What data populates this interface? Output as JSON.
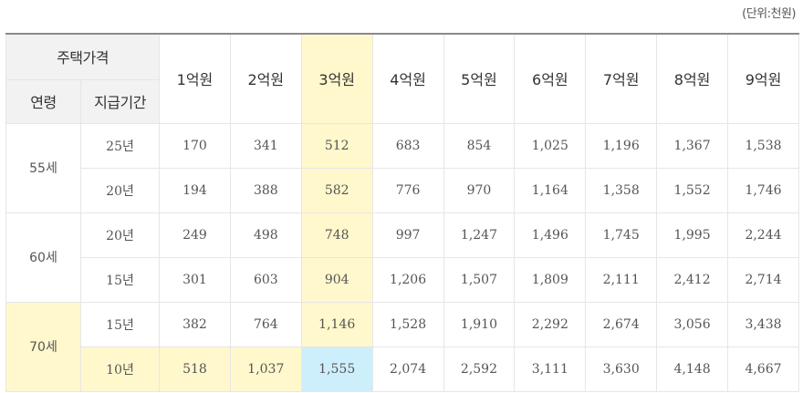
{
  "unit_label": "(단위:천원)",
  "header": {
    "price_label": "주택가격",
    "age_label": "연령",
    "period_label": "지급기간",
    "prices": [
      "1억원",
      "2억원",
      "3억원",
      "4억원",
      "5억원",
      "6억원",
      "7억원",
      "8억원",
      "9억원"
    ]
  },
  "groups": [
    {
      "age": "55세",
      "rows": [
        {
          "period": "25년",
          "values": [
            "170",
            "341",
            "512",
            "683",
            "854",
            "1,025",
            "1,196",
            "1,367",
            "1,538"
          ]
        },
        {
          "period": "20년",
          "values": [
            "194",
            "388",
            "582",
            "776",
            "970",
            "1,164",
            "1,358",
            "1,552",
            "1,746"
          ]
        }
      ]
    },
    {
      "age": "60세",
      "rows": [
        {
          "period": "20년",
          "values": [
            "249",
            "498",
            "748",
            "997",
            "1,247",
            "1,496",
            "1,745",
            "1,995",
            "2,244"
          ]
        },
        {
          "period": "15년",
          "values": [
            "301",
            "603",
            "904",
            "1,206",
            "1,507",
            "1,809",
            "2,111",
            "2,412",
            "2,714"
          ]
        }
      ]
    },
    {
      "age": "70세",
      "rows": [
        {
          "period": "15년",
          "values": [
            "382",
            "764",
            "1,146",
            "1,528",
            "1,910",
            "2,292",
            "2,674",
            "3,056",
            "3,438"
          ]
        },
        {
          "period": "10년",
          "values": [
            "518",
            "1,037",
            "1,555",
            "2,074",
            "2,592",
            "3,111",
            "3,630",
            "4,148",
            "4,667"
          ]
        }
      ]
    }
  ],
  "colors": {
    "highlight_yellow": "#fff8cc",
    "highlight_blue": "#cdeffb",
    "header_gray": "#f2f2f2"
  }
}
